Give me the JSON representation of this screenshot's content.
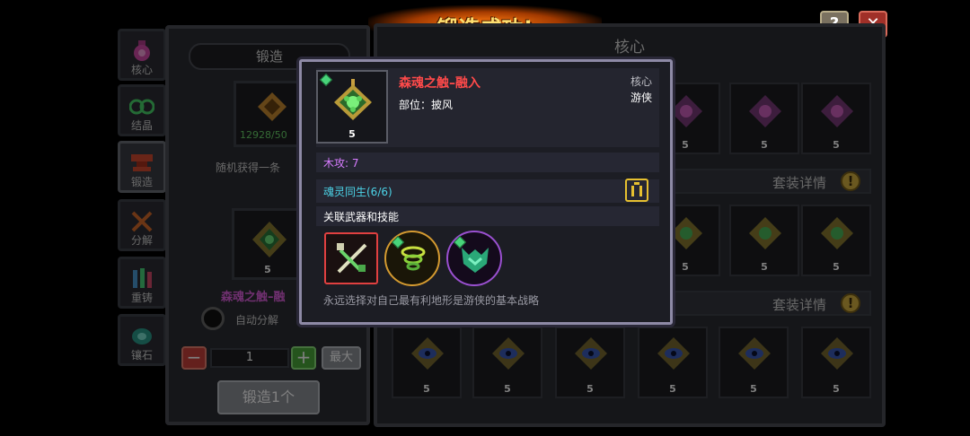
{
  "banner": {
    "title": "锻造成功!"
  },
  "top_buttons": {
    "help": "?",
    "close": "✕"
  },
  "sidebar": {
    "items": [
      {
        "label": "核心",
        "icon": "potion-icon"
      },
      {
        "label": "结晶",
        "icon": "crystal-icon"
      },
      {
        "label": "锻造",
        "icon": "anvil-icon"
      },
      {
        "label": "分解",
        "icon": "decompose-icon"
      },
      {
        "label": "重铸",
        "icon": "recast-icon"
      },
      {
        "label": "镶石",
        "icon": "gem-icon"
      }
    ]
  },
  "forge": {
    "title": "锻造",
    "material_count": "12928/50",
    "random_text": "随机获得一条",
    "result_level": "5",
    "item_name": "森魂之触–融",
    "auto_decompose": "自动分解",
    "minus": "−",
    "quantity": "1",
    "plus": "+",
    "max_label": "最大",
    "forge_button": "锻造1个"
  },
  "core_panel": {
    "title": "核心",
    "set_detail_label": "套装详情",
    "set_detail_icon": "!",
    "rows": [
      {
        "cells": [
          "5",
          "5",
          "5"
        ]
      },
      {
        "cells": [
          "5",
          "5",
          "5"
        ]
      },
      {
        "cells": [
          "5",
          "5",
          "5",
          "5",
          "5",
          "5"
        ]
      }
    ]
  },
  "popup": {
    "item_level": "5",
    "item_name": "森魂之触–融入",
    "category": "核心",
    "slot_text": "部位：披风",
    "class_name": "游侠",
    "stat": "木攻: 7",
    "set_name": "魂灵同生(6/6)",
    "linked_title": "关联武器和技能",
    "flavor": "永远选择对自己最有利地形是游侠的基本战略"
  },
  "colors": {
    "accent_red": "#ff4a4a",
    "stat_purple": "#d77cff",
    "set_cyan": "#4cd4e8",
    "gem_green": "#48d47a",
    "banner_orange": "#ff7a10"
  }
}
